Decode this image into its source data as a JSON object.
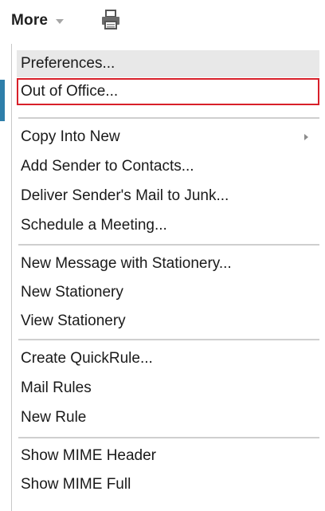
{
  "toolbar": {
    "more_label": "More",
    "more_icon": "chevron-down-icon",
    "print_icon": "printer-icon"
  },
  "colors": {
    "focus_outline": "#d8202a",
    "hover_background": "#e8e8e8",
    "accent": "#2e7faa"
  },
  "menu": {
    "items": [
      {
        "label": "Preferences..."
      },
      {
        "label": "Out of Office..."
      },
      {
        "label": "Copy Into New",
        "submenu": true
      },
      {
        "label": "Add Sender to Contacts..."
      },
      {
        "label": "Deliver Sender's Mail to Junk..."
      },
      {
        "label": "Schedule a Meeting..."
      },
      {
        "label": "New Message with Stationery..."
      },
      {
        "label": "New Stationery"
      },
      {
        "label": "View Stationery"
      },
      {
        "label": "Create QuickRule..."
      },
      {
        "label": "Mail Rules"
      },
      {
        "label": "New Rule"
      },
      {
        "label": "Show MIME Header"
      },
      {
        "label": "Show MIME Full"
      }
    ]
  }
}
